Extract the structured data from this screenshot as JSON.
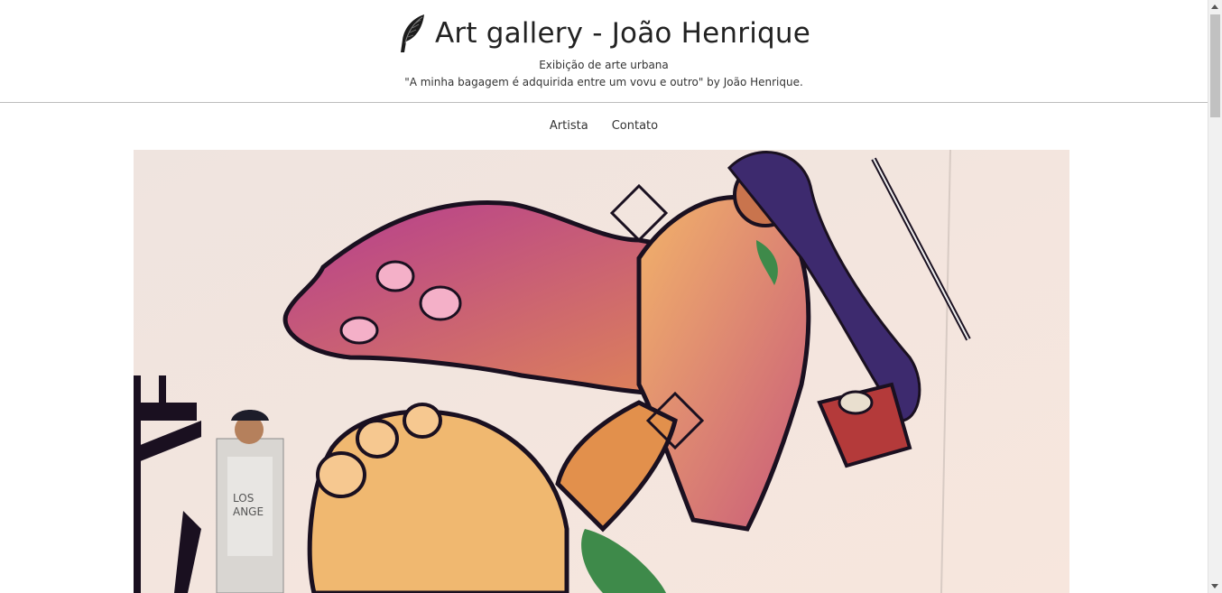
{
  "header": {
    "icon": "feather-quill-icon",
    "title": "Art gallery - João Henrique",
    "subtitle": "Exibição de arte urbana",
    "quote": "\"A minha bagagem é adquirida entre um vovu e outro\" by João Henrique."
  },
  "nav": {
    "items": [
      {
        "label": "Artista"
      },
      {
        "label": "Contato"
      }
    ]
  },
  "hero": {
    "image": "street-art-mural-photo"
  },
  "colors": {
    "header_border": "#bdbdbd",
    "text": "#222222",
    "mural_wall": "#f3e3dc",
    "mural_skin": "#e58a4a",
    "mural_magenta": "#b23a8c",
    "mural_outline": "#1a1020"
  }
}
